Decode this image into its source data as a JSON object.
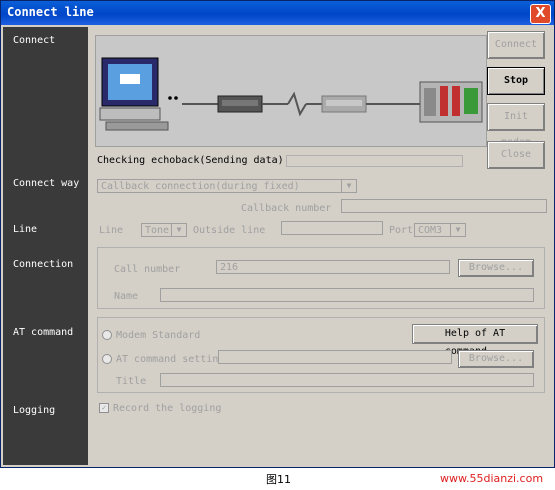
{
  "window": {
    "title": "Connect line",
    "close_glyph": "X"
  },
  "left_labels": {
    "connect": "Connect",
    "connect_way": "Connect way",
    "line": "Line",
    "connection": "Connection",
    "at_command": "AT command",
    "logging": "Logging"
  },
  "buttons": {
    "connect": "Connect",
    "stop": "Stop",
    "init_modem": "Init modem",
    "close": "Close",
    "browse1": "Browse...",
    "help_at": "Help of AT command...",
    "browse2": "Browse..."
  },
  "status": {
    "text": "Checking echoback(Sending data)"
  },
  "connect_way": {
    "value": "Callback connection(during fixed)",
    "callback_number_label": "Callback number",
    "callback_number": ""
  },
  "line": {
    "line_label": "Line",
    "line_type": "Tone",
    "outside_line_label": "Outside line",
    "outside_line": "",
    "port_label": "Port",
    "port": "COM3"
  },
  "connection": {
    "call_number_label": "Call number",
    "call_number": "216",
    "name_label": "Name",
    "name": ""
  },
  "at": {
    "modem_standard": "Modem Standard",
    "at_setting": "AT command setting",
    "title_label": "Title"
  },
  "logging": {
    "record_label": "Record the logging"
  },
  "footer": {
    "caption": "图11",
    "url": "www.55dianzi.com"
  }
}
